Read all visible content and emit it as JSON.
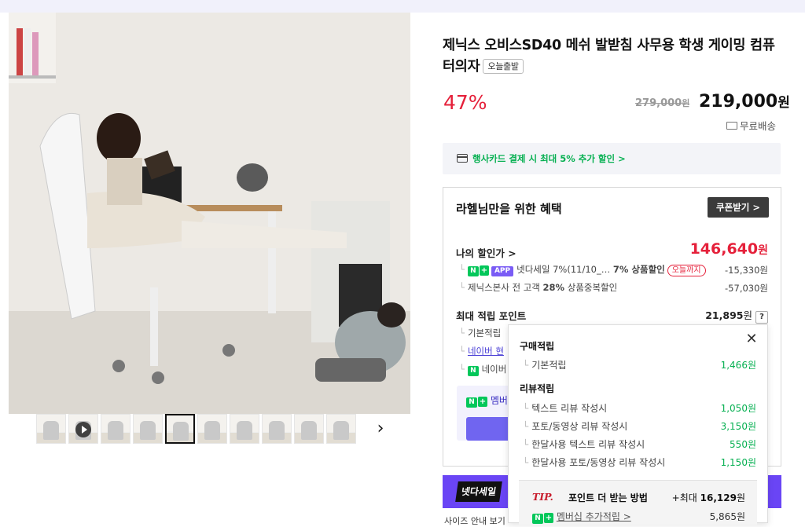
{
  "thumbnails": [
    {
      "name": "thumb-1",
      "video": false,
      "selected": false
    },
    {
      "name": "thumb-2",
      "video": true,
      "selected": false
    },
    {
      "name": "thumb-3",
      "video": false,
      "selected": false
    },
    {
      "name": "thumb-4",
      "video": false,
      "selected": false
    },
    {
      "name": "thumb-5",
      "video": false,
      "selected": true
    },
    {
      "name": "thumb-6",
      "video": false,
      "selected": false
    },
    {
      "name": "thumb-7",
      "video": false,
      "selected": false
    },
    {
      "name": "thumb-8",
      "video": false,
      "selected": false
    },
    {
      "name": "thumb-9",
      "video": false,
      "selected": false
    },
    {
      "name": "thumb-10",
      "video": false,
      "selected": false
    }
  ],
  "next_arrow": "›",
  "product": {
    "title": "제닉스 오비스SD40 메쉬 발받침 사무용 학생 게이밍 컴퓨터의자",
    "badge": "오늘출발",
    "discount": "47%",
    "original_price": "279,000",
    "original_unit": "원",
    "price": "219,000",
    "price_unit": "원",
    "shipping": "무료배송"
  },
  "card_promo": "행사카드 결제 시 최대 5% 추가 할인 >",
  "benefit": {
    "title": "라헬님만을 위한 혜택",
    "coupon_button": "쿠폰받기 >",
    "my_discount_label": "나의 할인가 >",
    "my_discount_value": "146,640",
    "my_discount_unit": "원",
    "sub1_app": "APP",
    "sub1_text": "넷다세일 7%(11/10_…",
    "sub1_text2": "7% 상품할인",
    "sub1_pill": "오늘까지",
    "sub1_value": "-15,330원",
    "sub2_text": "제닉스본사 전 고객",
    "sub2_bold": "28%",
    "sub2_text2": "상품중복할인",
    "sub2_value": "-57,030원",
    "max_point_label": "최대 적립 포인트",
    "max_point_value": "21,895",
    "max_point_unit": "원",
    "qmark": "?",
    "hidden_rows": [
      "기본적립",
      "네이버 현",
      "네이버"
    ],
    "member_text": "멤버",
    "ad_logo": "넷다세일",
    "bottom_text": "사이즈 안내 보기"
  },
  "popup": {
    "close": "✕",
    "purchase_title": "구매적립",
    "purchase_items": [
      {
        "label": "기본적립",
        "value": "1,466원"
      }
    ],
    "review_title": "리뷰적립",
    "review_items": [
      {
        "label": "텍스트 리뷰 작성시",
        "value": "1,050원"
      },
      {
        "label": "포토/동영상 리뷰 작성시",
        "value": "3,150원"
      },
      {
        "label": "한달사용 텍스트 리뷰 작성시",
        "value": "550원"
      },
      {
        "label": "한달사용 포토/동영상 리뷰 작성시",
        "value": "1,150원"
      }
    ],
    "tip_tag": "TIP.",
    "tip_text": "포인트 더 받는 방법",
    "tip_value_prefix": "+최대",
    "tip_value": "16,129",
    "tip_value_unit": "원",
    "member_link": "멤버십 추가적립 >",
    "member_value": "5,865원"
  },
  "colors": {
    "red": "#e5203a",
    "green": "#03c75a",
    "purple": "#6a45f5",
    "dark": "#3b3b3b"
  }
}
